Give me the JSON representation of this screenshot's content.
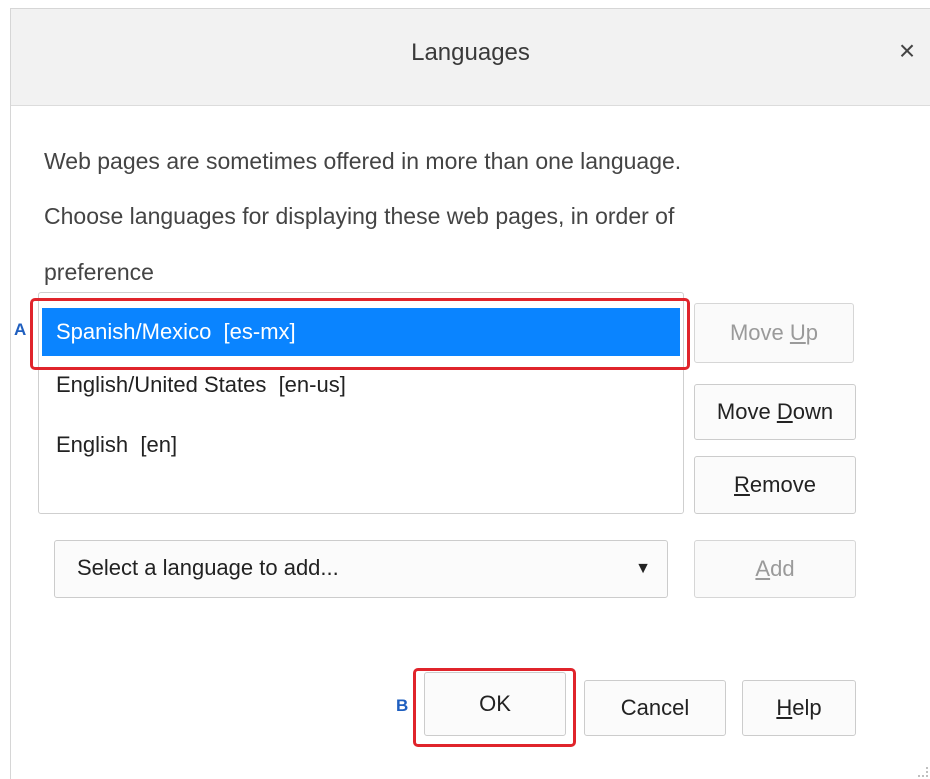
{
  "dialog": {
    "title": "Languages",
    "close_glyph": "×"
  },
  "description": {
    "line1": "Web pages are sometimes offered in more than one language.",
    "line2": "Choose languages for displaying these web pages, in order of",
    "line3": "preference"
  },
  "languages": [
    {
      "label": "Spanish/Mexico  [es-mx]",
      "selected": true
    },
    {
      "label": "English/United States  [en-us]",
      "selected": false
    },
    {
      "label": "English  [en]",
      "selected": false
    }
  ],
  "buttons": {
    "move_up": {
      "pre": "Move ",
      "accel": "U",
      "post": "p",
      "enabled": false
    },
    "move_down": {
      "pre": "Move ",
      "accel": "D",
      "post": "own",
      "enabled": true
    },
    "remove": {
      "pre": "",
      "accel": "R",
      "post": "emove",
      "enabled": true
    },
    "add": {
      "pre": "",
      "accel": "A",
      "post": "dd",
      "enabled": false
    },
    "ok": {
      "label": "OK"
    },
    "cancel": {
      "label": "Cancel"
    },
    "help": {
      "pre": "",
      "accel": "H",
      "post": "elp"
    }
  },
  "language_select": {
    "value": "Select a language to add..."
  },
  "annotations": {
    "a": "A",
    "b": "B"
  },
  "colors": {
    "selection": "#0a84ff",
    "highlight": "#e0242b",
    "marker": "#1f5fbf"
  },
  "icons": {
    "close": "close-icon",
    "dropdown": "dropdown-arrow-icon"
  }
}
